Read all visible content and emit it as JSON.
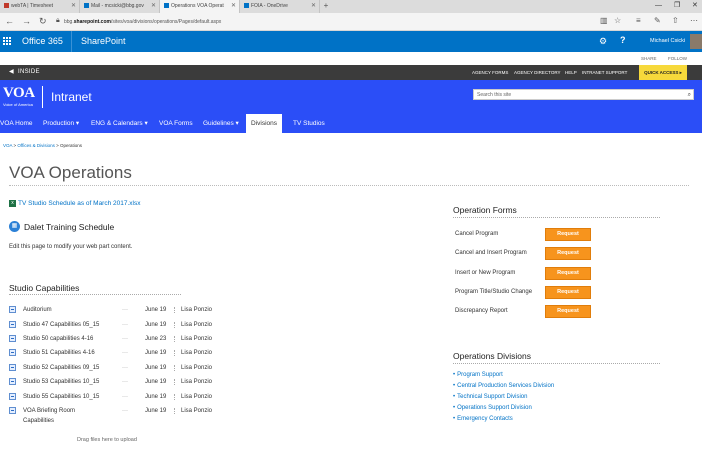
{
  "browser": {
    "tabs": [
      {
        "label": "webTA | Timesheet",
        "active": false,
        "color": "#c0392b"
      },
      {
        "label": "Mail - mcsicki@bbg.gov",
        "active": false,
        "color": "#0072c6"
      },
      {
        "label": "Operations VOA Operat",
        "active": true,
        "color": "#0072c6"
      },
      {
        "label": "FOIA - OneDrive",
        "active": false,
        "color": "#0072c6"
      }
    ],
    "new_tab": "+",
    "url_prefix": "bbg.",
    "url_domain": "sharepoint.com",
    "url_path": "/sites/voa/divisions/operations/Pages/default.aspx"
  },
  "o365": {
    "brand": "Office 365",
    "app": "SharePoint",
    "help": "?",
    "user": "Michael Csicki"
  },
  "share_row": {
    "share": "SHARE",
    "follow": "FOLLOW"
  },
  "inside_bar": {
    "inside_label": "INSIDE",
    "links": [
      "AGENCY FORMS",
      "AGENCY DIRECTORY",
      "HELP",
      "INTRANET SUPPORT"
    ],
    "quick_access": "QUICK ACCESS ▸"
  },
  "header": {
    "logo_text": "VOA",
    "logo_sub": "Voice of America",
    "site_title": "Intranet",
    "search_placeholder": "Search this site"
  },
  "nav": [
    {
      "label": "VOA Home",
      "active": false
    },
    {
      "label": "Production ▾",
      "active": false
    },
    {
      "label": "ENG & Calendars ▾",
      "active": false
    },
    {
      "label": "VOA Forms",
      "active": false
    },
    {
      "label": "Guidelines ▾",
      "active": false
    },
    {
      "label": "Divisions",
      "active": true
    },
    {
      "label": "TV Studios",
      "active": false
    }
  ],
  "breadcrumb": {
    "root": "VOA",
    "sep1": " > ",
    "mid": "Offices & Divisions",
    "sep2": " > ",
    "current": "Operations"
  },
  "page": {
    "title": "VOA Operations",
    "xlsx_link": "TV Studio Schedule as of March 2017.xlsx",
    "dalet_title": "Dalet Training Schedule",
    "edit_msg": "Edit this page to modify your web part content.",
    "studio_heading": "Studio Capabilities",
    "drag_files": "Drag files here to upload"
  },
  "studio_rows": [
    {
      "name": "Auditorium",
      "dots": "···",
      "date": "June 19",
      "who": "Lisa Ponzio"
    },
    {
      "name": "Studio 47 Capabilities 05_15",
      "dots": "···",
      "date": "June 19",
      "who": "Lisa Ponzio"
    },
    {
      "name": "Studio 50 capabilities 4-16",
      "dots": "···",
      "date": "June 23",
      "who": "Lisa Ponzio"
    },
    {
      "name": "Studio 51 Capabilities 4-16",
      "dots": "···",
      "date": "June 19",
      "who": "Lisa Ponzio"
    },
    {
      "name": "Studio 52 Capabilities 09_15",
      "dots": "···",
      "date": "June 19",
      "who": "Lisa Ponzio"
    },
    {
      "name": "Studio 53 Capabilities 10_15",
      "dots": "···",
      "date": "June 19",
      "who": "Lisa Ponzio"
    },
    {
      "name": "Studio 55 Capabilities 10_15",
      "dots": "···",
      "date": "June 19",
      "who": "Lisa Ponzio"
    },
    {
      "name": "VOA Briefing Room",
      "name2": "Capabilities",
      "dots": "···",
      "date": "June 19",
      "who": "Lisa Ponzio"
    }
  ],
  "operation_forms": {
    "heading": "Operation Forms",
    "items": [
      {
        "label": "Cancel Program",
        "button": "Request"
      },
      {
        "label": "Cancel and Insert Program",
        "button": "Request"
      },
      {
        "label": "Insert or New Program",
        "button": "Request"
      },
      {
        "label": "Program Title/Studio Change",
        "button": "Request"
      },
      {
        "label": "Discrepancy Report",
        "button": "Request"
      }
    ]
  },
  "operations_divisions": {
    "heading": "Operations Divisions",
    "items": [
      "Program Support",
      "Central Production Services Division",
      "Technical Support Division",
      "Operations Support Division",
      "Emergency Contacts"
    ]
  },
  "colors": {
    "o365_blue": "#0072c6",
    "site_blue": "#2b4ef7",
    "request_orange": "#f7941d",
    "quick_yellow": "#f7d93b"
  }
}
